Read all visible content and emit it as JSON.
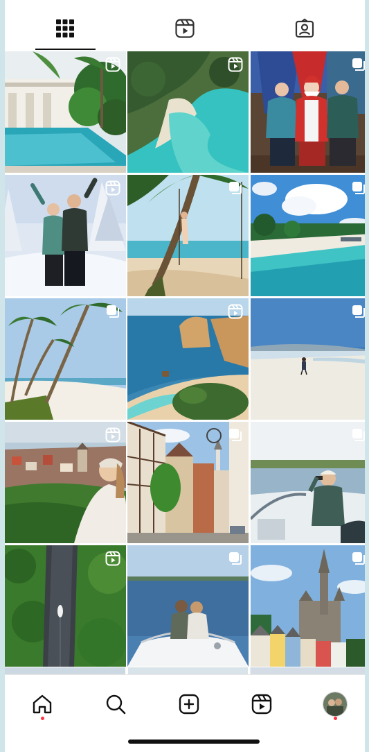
{
  "profile_tabs": [
    {
      "id": "posts",
      "icon": "grid-icon",
      "active": true
    },
    {
      "id": "reels",
      "icon": "reels-icon",
      "active": false
    },
    {
      "id": "tagged",
      "icon": "tagged-icon",
      "active": false
    }
  ],
  "grid": [
    {
      "subject": "resort-pool-palms",
      "badge": "reel"
    },
    {
      "subject": "aerial-beach-turquoise",
      "badge": "reel"
    },
    {
      "subject": "couple-with-santa",
      "badge": "carousel"
    },
    {
      "subject": "couple-in-snow",
      "badge": "reel"
    },
    {
      "subject": "palm-swing-beach",
      "badge": "carousel"
    },
    {
      "subject": "tropical-beach-clouds",
      "badge": "carousel"
    },
    {
      "subject": "leaning-palms-beach",
      "badge": "carousel"
    },
    {
      "subject": "rocky-coast-cove",
      "badge": "reel"
    },
    {
      "subject": "walker-on-beach",
      "badge": "carousel"
    },
    {
      "subject": "town-vineyard-view",
      "badge": "reel"
    },
    {
      "subject": "half-timbered-street",
      "badge": "carousel"
    },
    {
      "subject": "boat-binoculars",
      "badge": "carousel"
    },
    {
      "subject": "aerial-river-boat",
      "badge": "reel"
    },
    {
      "subject": "couple-on-boat-bow",
      "badge": "carousel"
    },
    {
      "subject": "cathedral-colorful-houses",
      "badge": "carousel"
    }
  ],
  "bottom_nav": [
    {
      "id": "home",
      "icon": "home-icon",
      "notification": true
    },
    {
      "id": "search",
      "icon": "search-icon",
      "notification": false
    },
    {
      "id": "create",
      "icon": "create-icon",
      "notification": false
    },
    {
      "id": "reels",
      "icon": "reels-icon",
      "notification": false
    },
    {
      "id": "profile",
      "icon": "avatar",
      "notification": true
    }
  ]
}
